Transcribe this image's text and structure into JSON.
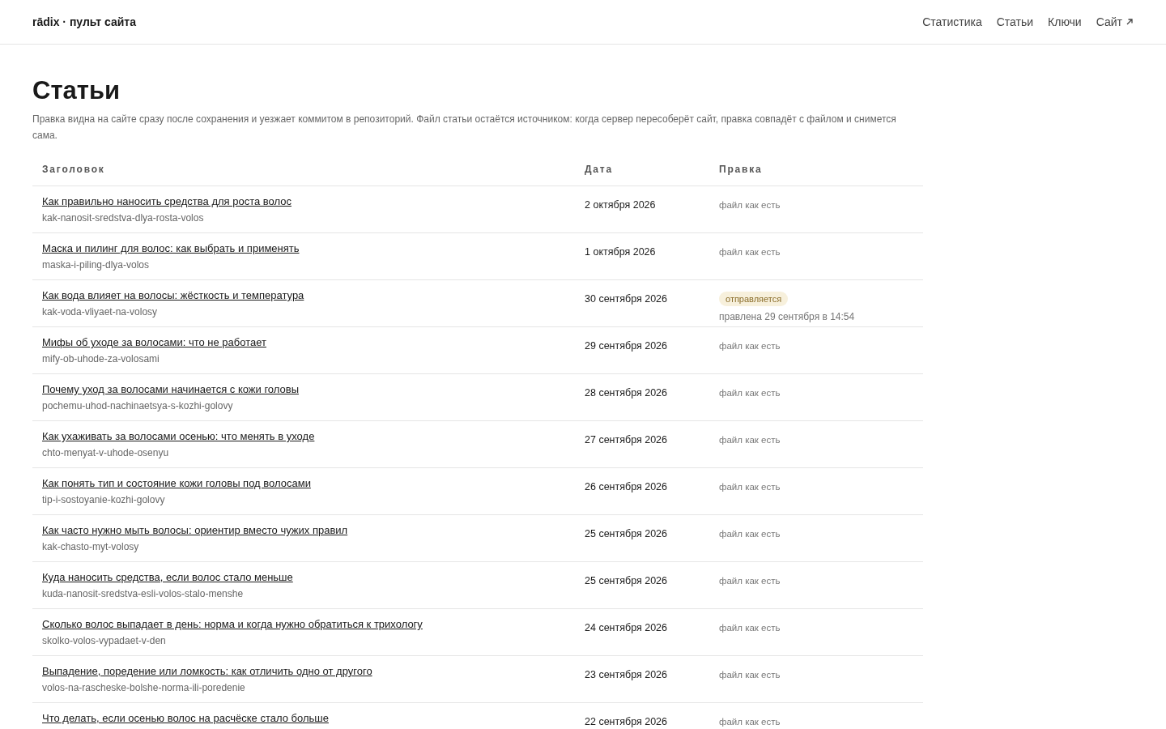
{
  "header": {
    "brand": "rādix · пульт сайта",
    "nav": [
      {
        "label": "Статистика",
        "external": false
      },
      {
        "label": "Статьи",
        "external": false
      },
      {
        "label": "Ключи",
        "external": false
      },
      {
        "label": "Сайт",
        "external": true
      }
    ]
  },
  "page": {
    "title": "Статьи",
    "description": "Правка видна на сайте сразу после сохранения и уезжает коммитом в репозиторий. Файл статьи остаётся источником: когда сервер пересоберёт сайт, правка совпадёт с файлом и снимется сама."
  },
  "table": {
    "columns": [
      "Заголовок",
      "Дата",
      "Правка"
    ],
    "rows": [
      {
        "title": "Как правильно наносить средства для роста волос",
        "slug": "kak-nanosit-sredstva-dlya-rosta-volos",
        "date": "2 октября 2026",
        "edit": {
          "kind": "file",
          "text": "файл как есть"
        }
      },
      {
        "title": "Маска и пилинг для волос: как выбрать и применять",
        "slug": "maska-i-piling-dlya-volos",
        "date": "1 октября 2026",
        "edit": {
          "kind": "file",
          "text": "файл как есть"
        }
      },
      {
        "title": "Как вода влияет на волосы: жёсткость и температура",
        "slug": "kak-voda-vliyaet-na-volosy",
        "date": "30 сентября 2026",
        "edit": {
          "kind": "pending",
          "badge": "отправляется",
          "text": "правлена 29 сентября в 14:54"
        }
      },
      {
        "title": "Мифы об уходе за волосами: что не работает",
        "slug": "mify-ob-uhode-za-volosami",
        "date": "29 сентября 2026",
        "edit": {
          "kind": "file",
          "text": "файл как есть"
        }
      },
      {
        "title": "Почему уход за волосами начинается с кожи головы",
        "slug": "pochemu-uhod-nachinaetsya-s-kozhi-golovy",
        "date": "28 сентября 2026",
        "edit": {
          "kind": "file",
          "text": "файл как есть"
        }
      },
      {
        "title": "Как ухаживать за волосами осенью: что менять в уходе",
        "slug": "chto-menyat-v-uhode-osenyu",
        "date": "27 сентября 2026",
        "edit": {
          "kind": "file",
          "text": "файл как есть"
        }
      },
      {
        "title": "Как понять тип и состояние кожи головы под волосами",
        "slug": "tip-i-sostoyanie-kozhi-golovy",
        "date": "26 сентября 2026",
        "edit": {
          "kind": "file",
          "text": "файл как есть"
        }
      },
      {
        "title": "Как часто нужно мыть волосы: ориентир вместо чужих правил",
        "slug": "kak-chasto-myt-volosy",
        "date": "25 сентября 2026",
        "edit": {
          "kind": "file",
          "text": "файл как есть"
        }
      },
      {
        "title": "Куда наносить средства, если волос стало меньше",
        "slug": "kuda-nanosit-sredstva-esli-volos-stalo-menshe",
        "date": "25 сентября 2026",
        "edit": {
          "kind": "file",
          "text": "файл как есть"
        }
      },
      {
        "title": "Сколько волос выпадает в день: норма и когда нужно обратиться к трихологу",
        "slug": "skolko-volos-vypadaet-v-den",
        "date": "24 сентября 2026",
        "edit": {
          "kind": "file",
          "text": "файл как есть"
        }
      },
      {
        "title": "Выпадение, поредение или ломкость: как отличить одно от другого",
        "slug": "volos-na-rascheske-bolshe-norma-ili-poredenie",
        "date": "23 сентября 2026",
        "edit": {
          "kind": "file",
          "text": "файл как есть"
        }
      },
      {
        "title": "Что делать, если осенью волос на расчёске стало больше",
        "date": "22 сентября 2026",
        "edit": {
          "kind": "file",
          "text": "файл как есть"
        }
      }
    ]
  }
}
